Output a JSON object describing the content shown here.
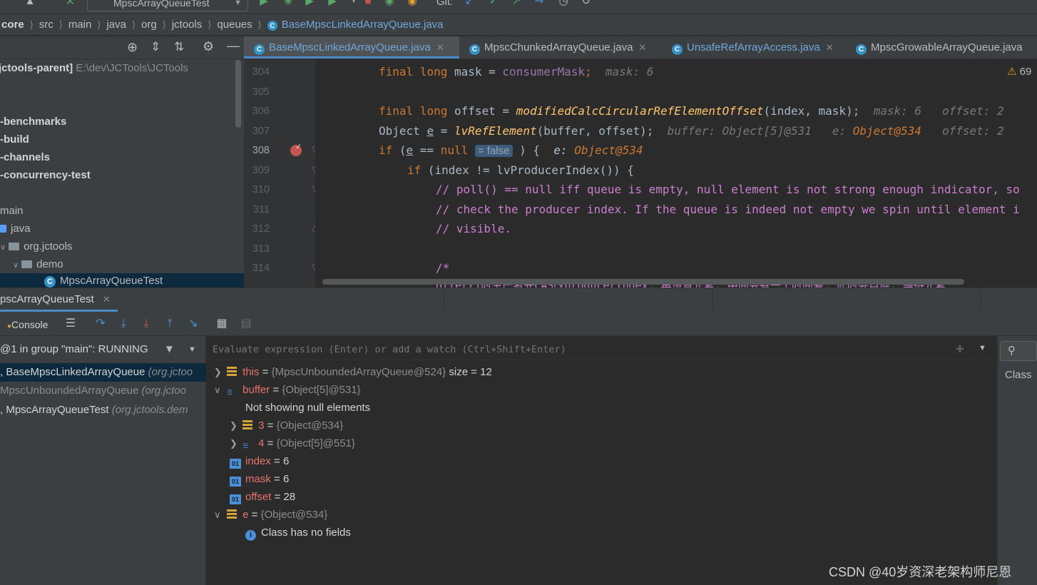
{
  "toolbar": {
    "run_config": "MpscArrayQueueTest",
    "git_label": "Git:"
  },
  "breadcrumb": [
    "core",
    "src",
    "main",
    "java",
    "org",
    "jctools",
    "queues",
    "BaseMpscLinkedArrayQueue.java"
  ],
  "project_tree": {
    "root_label": "jctools-parent]",
    "root_path": "E:\\dev\\JCTools\\JCTools",
    "modules": [
      "-benchmarks",
      "-build",
      "-channels",
      "-concurrency-test"
    ],
    "main": "main",
    "java": "java",
    "package": "org.jctools",
    "demo": "demo",
    "selected_file": "MpscArrayQueueTest"
  },
  "editor_tabs": [
    {
      "label": "BaseMpscLinkedArrayQueue.java",
      "active": true
    },
    {
      "label": "MpscChunkedArrayQueue.java",
      "active": false
    },
    {
      "label": "UnsafeRefArrayAccess.java",
      "active": false
    },
    {
      "label": "MpscGrowableArrayQueue.java",
      "active": false
    }
  ],
  "editor": {
    "warnings": "69",
    "line_numbers": [
      "304",
      "305",
      "306",
      "307",
      "308",
      "309",
      "310",
      "311",
      "312",
      "313",
      "314"
    ],
    "line304": {
      "kw1": "final",
      "kw2": "long",
      "var": "mask",
      "eq": " = ",
      "fld": "consumerMask",
      "semi": ";",
      "hint": "mask: 6"
    },
    "line306": {
      "kw1": "final",
      "kw2": "long",
      "var": "offset",
      "eq": " = ",
      "fn": "modifiedCalcCircularRefElementOffset",
      "args": "(index, mask);",
      "hint1": "mask: 6",
      "hint2": "offset: 2"
    },
    "line307": {
      "type": "Object",
      "var": "e",
      "eq": " = ",
      "fn": "lvRefElement",
      "args": "(buffer, offset);",
      "hint1": "buffer: Object[5]@531",
      "hint2": "e: ",
      "hint2val": "Object@534",
      "hint3": "offset: 2"
    },
    "line308": {
      "kw": "if",
      "pre": " (",
      "var": "e",
      "mid": " == ",
      "kw2": "null",
      "badge": "= false",
      "post": " ) {",
      "hint": "e: ",
      "hintval": "Object@534"
    },
    "line309": {
      "kw": "if",
      "text": " (index != lvProducerIndex()) {"
    },
    "line310": "// poll() == null iff queue is empty, null element is not strong enough indicator, so",
    "line311": "// check the producer index. If the queue is indeed not empty we spin until element i",
    "line312": "// visible.",
    "line314": "/*",
    "line315": "offer()时生产者先CAS改producerIndex, 再设置元素, 中间会有一个时间差, 此时会自旋, 等待元素"
  },
  "debug": {
    "tab_label": "pscArrayQueueTest",
    "console_label": "Console",
    "thread": "@1 in group \"main\": RUNNING",
    "frames": [
      {
        "method": ", BaseMpscLinkedArrayQueue",
        "pkg": "(org.jctoo"
      },
      {
        "method": "MpscUnboundedArrayQueue",
        "pkg": "(org.jctoo"
      },
      {
        "method": ", MpscArrayQueueTest",
        "pkg": "(org.jctools.dem"
      }
    ],
    "eval_placeholder": "Evaluate expression (Enter) or add a watch (Ctrl+Shift+Enter)",
    "vars": {
      "this_name": "this",
      "this_val": "{MpscUnboundedArrayQueue@524}",
      "this_extra": "size = 12",
      "buffer_name": "buffer",
      "buffer_val": "{Object[5]@531}",
      "null_note": "Not showing null elements",
      "el3_name": "3",
      "el3_val": "{Object@534}",
      "el4_name": "4",
      "el4_val": "{Object[5]@551}",
      "index_name": "index",
      "index_val": "6",
      "mask_name": "mask",
      "mask_val": "6",
      "offset_name": "offset",
      "offset_val": "28",
      "e_name": "e",
      "e_val": "{Object@534}",
      "e_note": "Class has no fields",
      "eq": " = "
    },
    "class_col": "Class"
  },
  "watermark": "CSDN @40岁资深老架构师尼恩",
  "colors": {
    "accent": "#4a88c7",
    "current_line": "#2d6099",
    "keyword": "#cc7832",
    "comment": "#cc7fd0",
    "var_name": "#e8736e"
  }
}
